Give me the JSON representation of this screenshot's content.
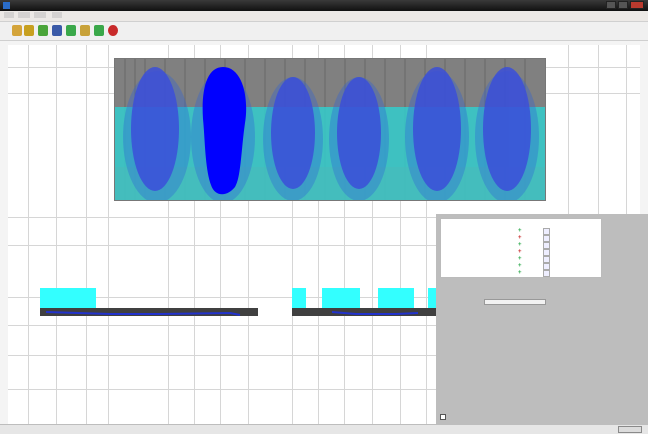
{
  "window": {
    "title": "",
    "window_buttons": [
      "minimize",
      "maximize",
      "close"
    ]
  },
  "menubar": {
    "items": []
  },
  "toolbar": {
    "icons": [
      {
        "name": "open-icon",
        "color": "#d4a43a"
      },
      {
        "name": "folder-icon",
        "color": "#c7a020"
      },
      {
        "name": "forward-icon",
        "color": "#4aa53a"
      },
      {
        "name": "grid-icon",
        "color": "#3a5aa8"
      },
      {
        "name": "plus-icon",
        "color": "#3aa84a"
      },
      {
        "name": "flag-icon",
        "color": "#c8a23a"
      },
      {
        "name": "marker-icon",
        "color": "#3aa84a"
      },
      {
        "name": "stop-icon",
        "color": "#c82a2a"
      }
    ],
    "sub_text": ""
  },
  "heatmap": {
    "background_color": "#808080",
    "middle_band_color": "#33cccc",
    "lower_band_color": "#40c0c0",
    "shape_color": "#3b4fd9",
    "highlight_color": "#0000ff",
    "selected_index": 1
  },
  "timeline": {
    "fill_color": "#33ffff",
    "bar_color": "#404040",
    "line_color": "#2233cc"
  },
  "table": {
    "headers": [
      "",
      "",
      "",
      "",
      ""
    ],
    "rows": [
      {
        "a": "",
        "b": "",
        "status": "up",
        "d": ""
      },
      {
        "a": "",
        "b": "",
        "status": "up",
        "d": ""
      },
      {
        "a": "",
        "b": "",
        "status": "up",
        "d": ""
      },
      {
        "a": "",
        "b": "",
        "status": "up",
        "d": ""
      },
      {
        "a": "",
        "b": "",
        "status": "up",
        "d": ""
      },
      {
        "a": "",
        "b": "",
        "status": "up",
        "d": ""
      },
      {
        "a": "",
        "b": "",
        "status": "up",
        "d": ""
      }
    ]
  },
  "slider": {
    "label": "",
    "value": ""
  },
  "status_bar": {
    "left": "",
    "button_label": ""
  },
  "checkbox": {
    "label": ""
  }
}
